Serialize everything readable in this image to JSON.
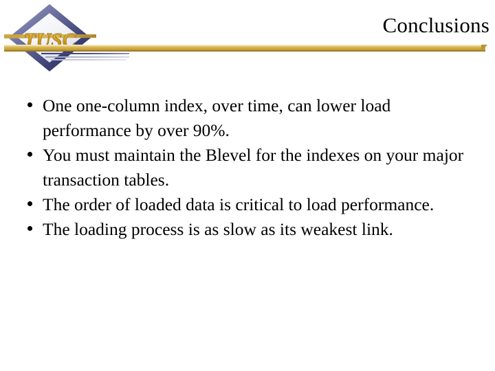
{
  "slide": {
    "title": "Conclusions",
    "logo": {
      "wordmark": "TUSC",
      "shape": "diamond",
      "border_color": "#3b3f74",
      "border_highlight_color": "#a8acd0",
      "wordmark_color": "#d4a017"
    },
    "accent_colors": {
      "gold_bar_light": "#e8cf84",
      "gold_bar_mid": "#c8a23a",
      "gold_bar_dark": "#8a6a1c",
      "navy": "#3b3f74",
      "text": "#000000",
      "background": "#ffffff"
    },
    "bullets": [
      "One one-column index, over time, can lower load performance by over 90%.",
      "You must maintain the Blevel for the indexes on your major transaction tables.",
      "The order of loaded data is critical to load performance.",
      "The loading process is as slow as its weakest link."
    ]
  }
}
